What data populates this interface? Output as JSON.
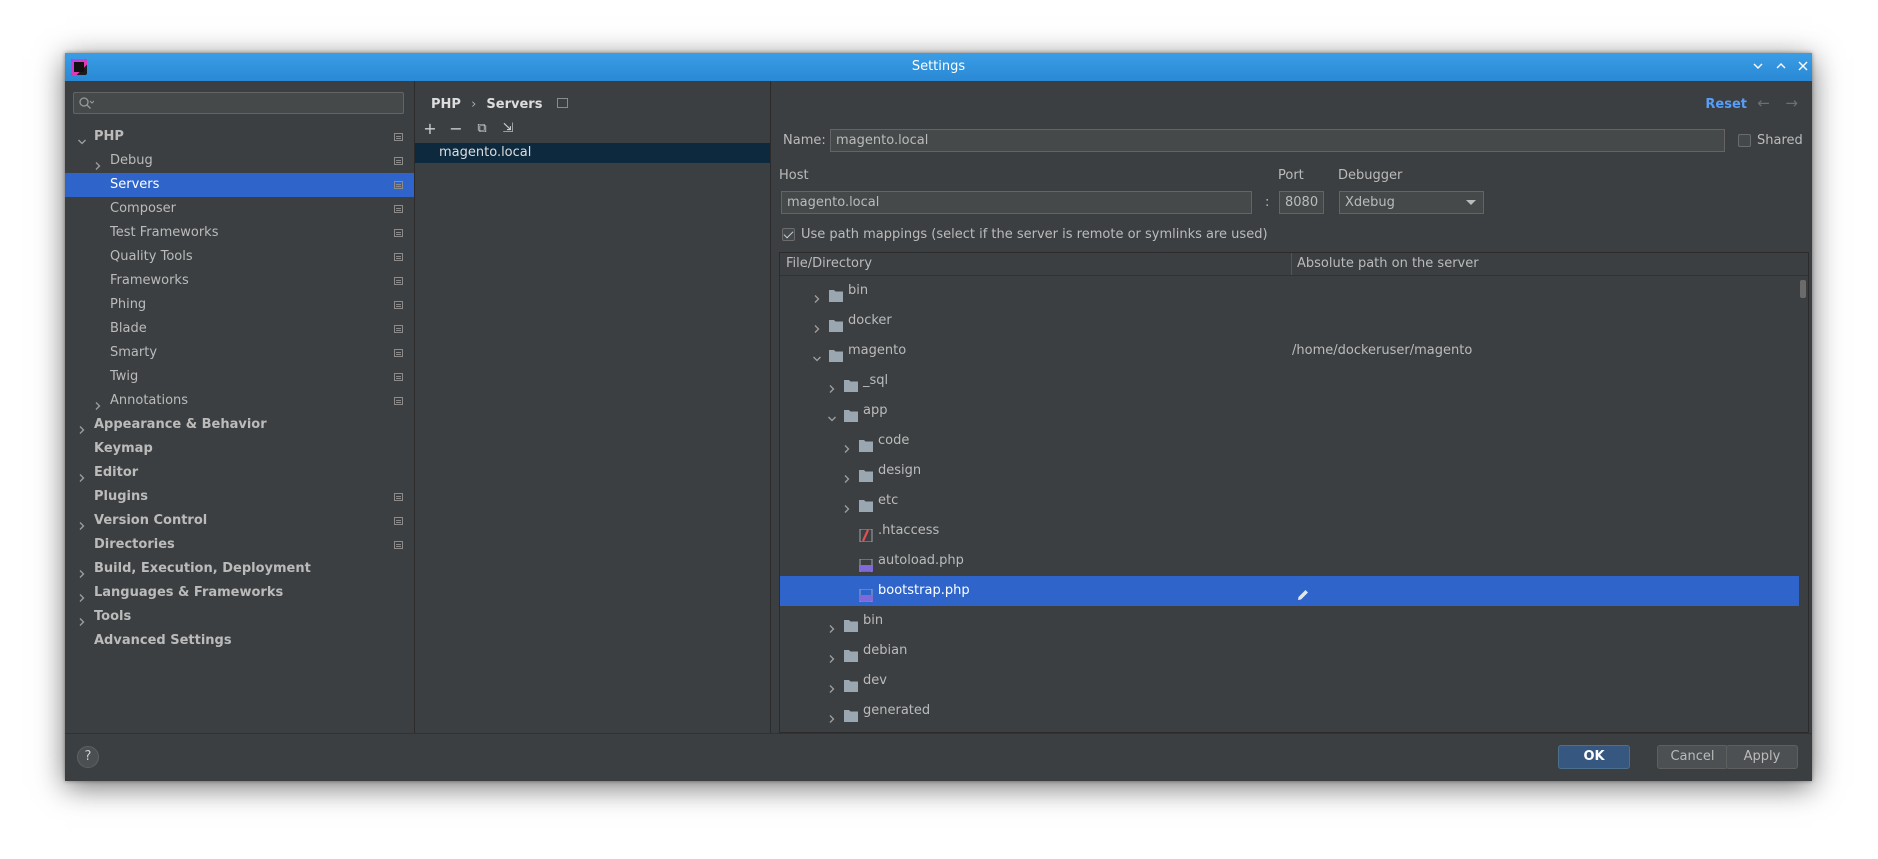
{
  "window": {
    "title": "Settings"
  },
  "sidebar": {
    "search_placeholder": "",
    "items": [
      {
        "label": "PHP",
        "bold": true,
        "indent": 0,
        "chevron": "down",
        "badge": true
      },
      {
        "label": "Debug",
        "bold": false,
        "indent": 1,
        "chevron": "right",
        "badge": true
      },
      {
        "label": "Servers",
        "bold": false,
        "indent": 1,
        "chevron": "none",
        "badge": true,
        "selected": true
      },
      {
        "label": "Composer",
        "bold": false,
        "indent": 1,
        "chevron": "none",
        "badge": true
      },
      {
        "label": "Test Frameworks",
        "bold": false,
        "indent": 1,
        "chevron": "none",
        "badge": true
      },
      {
        "label": "Quality Tools",
        "bold": false,
        "indent": 1,
        "chevron": "none",
        "badge": true
      },
      {
        "label": "Frameworks",
        "bold": false,
        "indent": 1,
        "chevron": "none",
        "badge": true
      },
      {
        "label": "Phing",
        "bold": false,
        "indent": 1,
        "chevron": "none",
        "badge": true
      },
      {
        "label": "Blade",
        "bold": false,
        "indent": 1,
        "chevron": "none",
        "badge": true
      },
      {
        "label": "Smarty",
        "bold": false,
        "indent": 1,
        "chevron": "none",
        "badge": true
      },
      {
        "label": "Twig",
        "bold": false,
        "indent": 1,
        "chevron": "none",
        "badge": true
      },
      {
        "label": "Annotations",
        "bold": false,
        "indent": 1,
        "chevron": "right",
        "badge": true
      },
      {
        "label": "Appearance & Behavior",
        "bold": true,
        "indent": 0,
        "chevron": "right",
        "badge": false
      },
      {
        "label": "Keymap",
        "bold": true,
        "indent": 0,
        "chevron": "none",
        "badge": false
      },
      {
        "label": "Editor",
        "bold": true,
        "indent": 0,
        "chevron": "right",
        "badge": false
      },
      {
        "label": "Plugins",
        "bold": true,
        "indent": 0,
        "chevron": "none",
        "badge": true
      },
      {
        "label": "Version Control",
        "bold": true,
        "indent": 0,
        "chevron": "right",
        "badge": true
      },
      {
        "label": "Directories",
        "bold": true,
        "indent": 0,
        "chevron": "none",
        "badge": true
      },
      {
        "label": "Build, Execution, Deployment",
        "bold": true,
        "indent": 0,
        "chevron": "right",
        "badge": false
      },
      {
        "label": "Languages & Frameworks",
        "bold": true,
        "indent": 0,
        "chevron": "right",
        "badge": false
      },
      {
        "label": "Tools",
        "bold": true,
        "indent": 0,
        "chevron": "right",
        "badge": false
      },
      {
        "label": "Advanced Settings",
        "bold": true,
        "indent": 0,
        "chevron": "none",
        "badge": false
      }
    ]
  },
  "breadcrumb": {
    "parent": "PHP",
    "separator": "›",
    "current": "Servers"
  },
  "header": {
    "reset_label": "Reset",
    "back_arrow": "←",
    "forward_arrow": "→"
  },
  "servers": {
    "toolbar": {
      "add": "+",
      "remove": "−",
      "copy": "⧉",
      "import": "⇲"
    },
    "list": [
      "magento.local"
    ]
  },
  "form": {
    "name_label": "Name:",
    "name_value": "magento.local",
    "shared_label": "Shared",
    "shared_checked": false,
    "host_label": "Host",
    "host_value": "magento.local",
    "port_sep": ":",
    "port_label": "Port",
    "port_value": "8080",
    "debugger_label": "Debugger",
    "debugger_value": "Xdebug",
    "path_mappings_label": "Use path mappings (select if the server is remote or symlinks are used)",
    "path_mappings_checked": true
  },
  "mapping_table": {
    "col_file": "File/Directory",
    "col_path": "Absolute path on the server",
    "rows": [
      {
        "name": "bin",
        "depth": 0,
        "chevron": "right",
        "icon": "folder",
        "path": ""
      },
      {
        "name": "docker",
        "depth": 0,
        "chevron": "right",
        "icon": "folder",
        "path": ""
      },
      {
        "name": "magento",
        "depth": 0,
        "chevron": "down",
        "icon": "folder",
        "path": "/home/dockeruser/magento"
      },
      {
        "name": "_sql",
        "depth": 1,
        "chevron": "right",
        "icon": "folder",
        "path": ""
      },
      {
        "name": "app",
        "depth": 1,
        "chevron": "down",
        "icon": "folder",
        "path": ""
      },
      {
        "name": "code",
        "depth": 2,
        "chevron": "right",
        "icon": "folder",
        "path": ""
      },
      {
        "name": "design",
        "depth": 2,
        "chevron": "right",
        "icon": "folder",
        "path": ""
      },
      {
        "name": "etc",
        "depth": 2,
        "chevron": "right",
        "icon": "folder",
        "path": ""
      },
      {
        "name": ".htaccess",
        "depth": 2,
        "chevron": "none",
        "icon": "htaccess",
        "path": ""
      },
      {
        "name": "autoload.php",
        "depth": 2,
        "chevron": "none",
        "icon": "php",
        "path": ""
      },
      {
        "name": "bootstrap.php",
        "depth": 2,
        "chevron": "none",
        "icon": "php",
        "path": "",
        "selected": true,
        "editable": true
      },
      {
        "name": "bin",
        "depth": 1,
        "chevron": "right",
        "icon": "folder",
        "path": ""
      },
      {
        "name": "debian",
        "depth": 1,
        "chevron": "right",
        "icon": "folder",
        "path": ""
      },
      {
        "name": "dev",
        "depth": 1,
        "chevron": "right",
        "icon": "folder",
        "path": ""
      },
      {
        "name": "generated",
        "depth": 1,
        "chevron": "right",
        "icon": "folder",
        "path": ""
      }
    ]
  },
  "footer": {
    "help_label": "?",
    "ok_label": "OK",
    "cancel_label": "Cancel",
    "apply_label": "Apply"
  },
  "colors": {
    "titlebar": "#2a88d4",
    "selection": "#2f65ca",
    "panel": "#3c3f41",
    "server_selection": "#0d293e",
    "link": "#589df6",
    "primary_button": "#365880"
  }
}
